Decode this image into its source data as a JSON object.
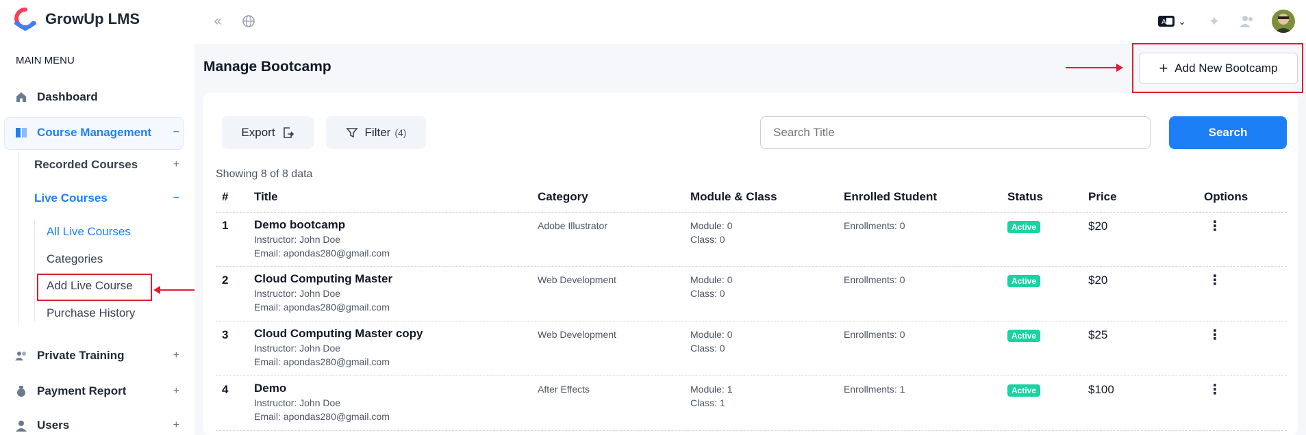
{
  "app": {
    "name": "GrowUp LMS"
  },
  "sidebar": {
    "menu_title": "MAIN MENU",
    "dashboard": "Dashboard",
    "course_management": "Course Management",
    "recorded_courses": "Recorded Courses",
    "live_courses": "Live Courses",
    "live_sub": [
      "All Live Courses",
      "Categories",
      "Add Live Course",
      "Purchase History"
    ],
    "private_training": "Private Training",
    "payment_report": "Payment Report",
    "users": "Users",
    "plus": "+",
    "minus": "−"
  },
  "main": {
    "title": "Manage Bootcamp",
    "add_button": "Add New Bootcamp",
    "export": "Export",
    "filter": "Filter",
    "filter_count": "(4)",
    "search_placeholder": "Search Title",
    "search_button": "Search",
    "showing": "Showing 8 of 8 data"
  },
  "table": {
    "headers": [
      "#",
      "Title",
      "Category",
      "Module & Class",
      "Enrolled Student",
      "Status",
      "Price",
      "Options"
    ],
    "rows": [
      {
        "num": "1",
        "title": "Demo bootcamp",
        "instructor": "Instructor: John Doe",
        "email": "Email: apondas280@gmail.com",
        "category": "Adobe Illustrator",
        "module": "Module: 0",
        "class": "Class: 0",
        "enrolled": "Enrollments: 0",
        "status": "Active",
        "price": "$20"
      },
      {
        "num": "2",
        "title": "Cloud Computing Master",
        "instructor": "Instructor: John Doe",
        "email": "Email: apondas280@gmail.com",
        "category": "Web Development",
        "module": "Module: 0",
        "class": "Class: 0",
        "enrolled": "Enrollments: 0",
        "status": "Active",
        "price": "$20"
      },
      {
        "num": "3",
        "title": "Cloud Computing Master copy",
        "instructor": "Instructor: John Doe",
        "email": "Email: apondas280@gmail.com",
        "category": "Web Development",
        "module": "Module: 0",
        "class": "Class: 0",
        "enrolled": "Enrollments: 0",
        "status": "Active",
        "price": "$25"
      },
      {
        "num": "4",
        "title": "Demo",
        "instructor": "Instructor: John Doe",
        "email": "Email: apondas280@gmail.com",
        "category": "After Effects",
        "module": "Module: 1",
        "class": "Class: 1",
        "enrolled": "Enrollments: 1",
        "status": "Active",
        "price": "$100"
      }
    ],
    "options_glyph": "⋮"
  },
  "colors": {
    "accent": "#1d7ff5",
    "active_badge": "#19d3a2",
    "annotation": "#e11d2e"
  }
}
